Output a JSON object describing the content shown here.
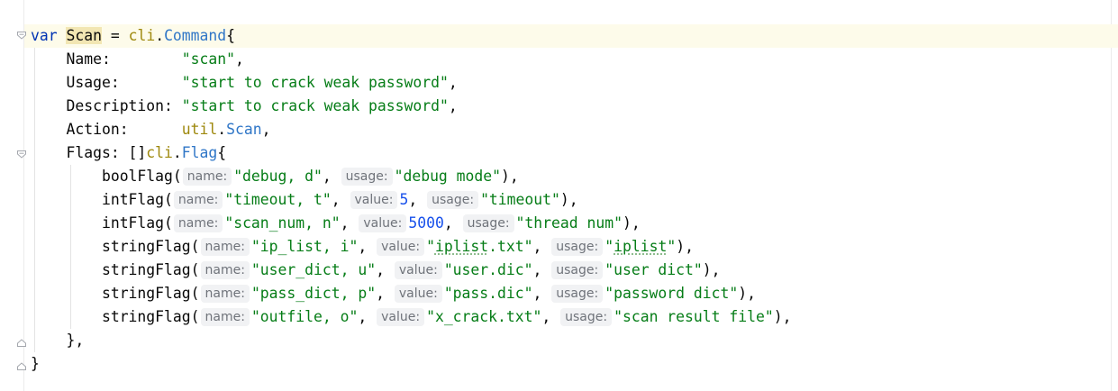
{
  "code": {
    "line1": {
      "kw": "var",
      "name": "Scan",
      "eq": " = ",
      "pkg": "cli",
      "dot": ".",
      "type": "Command",
      "brace": "{"
    },
    "line2": {
      "key": "Name:        ",
      "val": "\"scan\"",
      "tail": ","
    },
    "line3": {
      "key": "Usage:       ",
      "val": "\"start to crack weak password\"",
      "tail": ","
    },
    "line4": {
      "key": "Description: ",
      "val": "\"start to crack weak password\"",
      "tail": ","
    },
    "line5": {
      "key": "Action:      ",
      "pkg": "util",
      "dot": ".",
      "fn": "Scan",
      "tail": ","
    },
    "line6": {
      "key": "Flags: []",
      "pkg": "cli",
      "dot": ".",
      "type": "Flag",
      "brace": "{"
    },
    "line7": {
      "fn": "boolFlag(",
      "h1": "name:",
      "v1": "\"debug, d\"",
      "s1": ", ",
      "h2": "usage:",
      "v2": "\"debug mode\"",
      "tail": "),"
    },
    "line8": {
      "fn": "intFlag(",
      "h1": "name:",
      "v1": "\"timeout, t\"",
      "s1": ", ",
      "h2": "value:",
      "v2": "5",
      "s2": ", ",
      "h3": "usage:",
      "v3": "\"timeout\"",
      "tail": "),"
    },
    "line9": {
      "fn": "intFlag(",
      "h1": "name:",
      "v1": "\"scan_num, n\"",
      "s1": ", ",
      "h2": "value:",
      "v2": "5000",
      "s2": ", ",
      "h3": "usage:",
      "v3": "\"thread num\"",
      "tail": "),"
    },
    "line10": {
      "fn": "stringFlag(",
      "h1": "name:",
      "v1": "\"ip_list, i\"",
      "s1": ", ",
      "h2": "value:",
      "v2a": "\"",
      "v2b": "iplist",
      "v2c": ".txt\"",
      "s2": ", ",
      "h3": "usage:",
      "v3a": "\"",
      "v3b": "iplist",
      "v3c": "\"",
      "tail": "),"
    },
    "line11": {
      "fn": "stringFlag(",
      "h1": "name:",
      "v1": "\"user_dict, u\"",
      "s1": ", ",
      "h2": "value:",
      "v2": "\"user.dic\"",
      "s2": ", ",
      "h3": "usage:",
      "v3": "\"user dict\"",
      "tail": "),"
    },
    "line12": {
      "fn": "stringFlag(",
      "h1": "name:",
      "v1": "\"pass_dict, p\"",
      "s1": ", ",
      "h2": "value:",
      "v2": "\"pass.dic\"",
      "s2": ", ",
      "h3": "usage:",
      "v3": "\"password dict\"",
      "tail": "),"
    },
    "line13": {
      "fn": "stringFlag(",
      "h1": "name:",
      "v1": "\"outfile, o\"",
      "s1": ", ",
      "h2": "value:",
      "v2": "\"x_crack.txt\"",
      "s2": ", ",
      "h3": "usage:",
      "v3": "\"scan result file\"",
      "tail": "),"
    },
    "line14": {
      "text": "},"
    },
    "line15": {
      "text": "}"
    }
  }
}
